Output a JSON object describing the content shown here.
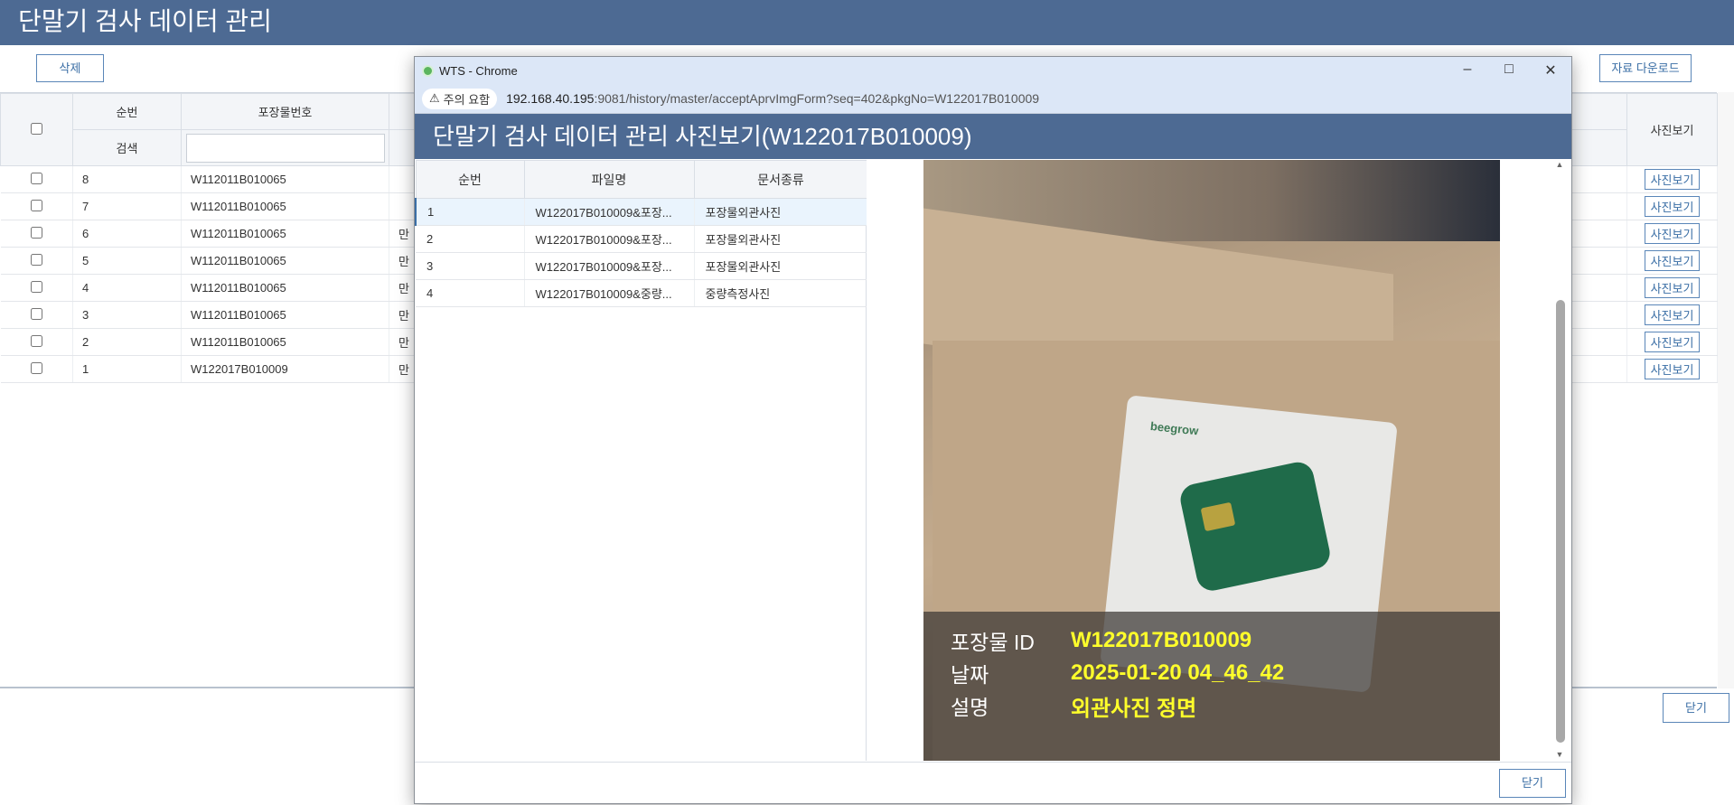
{
  "page": {
    "title": "단말기 검사 데이터 관리",
    "delete_label": "삭제",
    "download_label": "자료 다운로드",
    "close_label": "닫기",
    "columns": {
      "seq": "순번",
      "pkg_no": "포장물번호",
      "photo": "사진보기",
      "search": "검색"
    },
    "rows": [
      {
        "seq": "8",
        "pkg": "W112011B010065",
        "extra": "",
        "photo": "사진보기"
      },
      {
        "seq": "7",
        "pkg": "W112011B010065",
        "extra": "",
        "photo": "사진보기"
      },
      {
        "seq": "6",
        "pkg": "W112011B010065",
        "extra": "만",
        "photo": "사진보기"
      },
      {
        "seq": "5",
        "pkg": "W112011B010065",
        "extra": "만",
        "photo": "사진보기"
      },
      {
        "seq": "4",
        "pkg": "W112011B010065",
        "extra": "만",
        "photo": "사진보기"
      },
      {
        "seq": "3",
        "pkg": "W112011B010065",
        "extra": "만",
        "photo": "사진보기"
      },
      {
        "seq": "2",
        "pkg": "W112011B010065",
        "extra": "만",
        "photo": "사진보기"
      },
      {
        "seq": "1",
        "pkg": "W122017B010009",
        "extra": "만",
        "photo": "사진보기"
      }
    ]
  },
  "popup": {
    "window_title": "WTS - Chrome",
    "security_label": "주의 요함",
    "url_host": "192.168.40.195",
    "url_rest": ":9081/history/master/acceptAprvImgForm?seq=402&pkgNo=W122017B010009",
    "header": "단말기 검사 데이터 관리 사진보기(W122017B010009)",
    "columns": {
      "seq": "순번",
      "file": "파일명",
      "doc_type": "문서종류"
    },
    "files": [
      {
        "seq": "1",
        "file": "W122017B010009&포장...",
        "doc_type": "포장물외관사진"
      },
      {
        "seq": "2",
        "file": "W122017B010009&포장...",
        "doc_type": "포장물외관사진"
      },
      {
        "seq": "3",
        "file": "W122017B010009&포장...",
        "doc_type": "포장물외관사진"
      },
      {
        "seq": "4",
        "file": "W122017B010009&중량...",
        "doc_type": "중량측정사진"
      }
    ],
    "photo": {
      "brand": "beegrow",
      "id_label": "포장물 ID",
      "id_value": "W122017B010009",
      "date_label": "날짜",
      "date_value": "2025-01-20 04_46_42",
      "desc_label": "설명",
      "desc_value": "외관사진 정면"
    },
    "close_label": "닫기"
  }
}
